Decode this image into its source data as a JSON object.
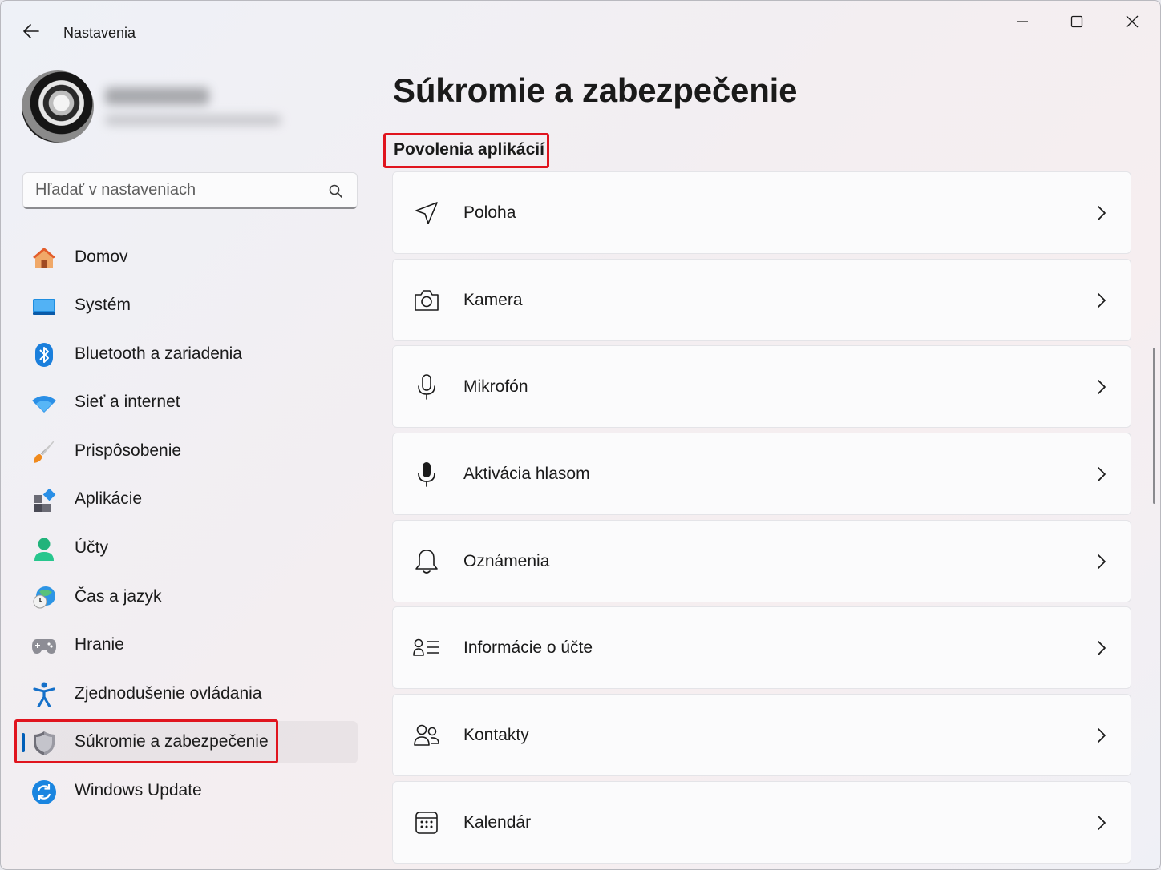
{
  "window": {
    "title": "Nastavenia",
    "controls": [
      "minimize",
      "maximize",
      "close"
    ]
  },
  "search": {
    "placeholder": "Hľadať v nastaveniach"
  },
  "sidebar": {
    "items": [
      {
        "label": "Domov",
        "icon": "home-icon"
      },
      {
        "label": "Systém",
        "icon": "system-icon"
      },
      {
        "label": "Bluetooth a zariadenia",
        "icon": "bluetooth-icon"
      },
      {
        "label": "Sieť a internet",
        "icon": "wifi-icon"
      },
      {
        "label": "Prispôsobenie",
        "icon": "brush-icon"
      },
      {
        "label": "Aplikácie",
        "icon": "apps-icon"
      },
      {
        "label": "Účty",
        "icon": "account-icon"
      },
      {
        "label": "Čas a jazyk",
        "icon": "time-language-icon"
      },
      {
        "label": "Hranie",
        "icon": "gamepad-icon"
      },
      {
        "label": "Zjednodušenie ovládania",
        "icon": "accessibility-icon"
      },
      {
        "label": "Súkromie a zabezpečenie",
        "icon": "shield-icon",
        "active": true
      },
      {
        "label": "Windows Update",
        "icon": "update-icon"
      }
    ]
  },
  "main": {
    "title": "Súkromie a zabezpečenie",
    "section": "Povolenia aplikácií",
    "rows": [
      {
        "label": "Poloha",
        "icon": "location-icon"
      },
      {
        "label": "Kamera",
        "icon": "camera-icon"
      },
      {
        "label": "Mikrofón",
        "icon": "microphone-icon"
      },
      {
        "label": "Aktivácia hlasom",
        "icon": "voice-activation-icon"
      },
      {
        "label": "Oznámenia",
        "icon": "bell-icon"
      },
      {
        "label": "Informácie o účte",
        "icon": "account-info-icon"
      },
      {
        "label": "Kontakty",
        "icon": "contacts-icon"
      },
      {
        "label": "Kalendár",
        "icon": "calendar-icon"
      }
    ]
  },
  "colors": {
    "accent": "#005fb8",
    "highlight": "#e0141e"
  }
}
